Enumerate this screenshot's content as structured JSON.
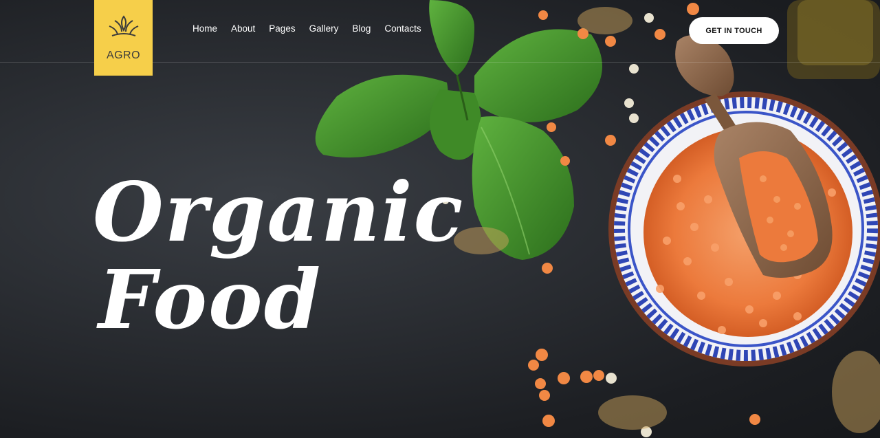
{
  "brand": {
    "name": "AGRO",
    "logo_icon": "leaf-icon",
    "accent": "#f6cf4a"
  },
  "nav": {
    "items": [
      "Home",
      "About",
      "Pages",
      "Gallery",
      "Blog",
      "Contacts"
    ]
  },
  "cta": {
    "label": "GET IN TOUCH"
  },
  "hero": {
    "line1": "Organic",
    "line2": "Food"
  },
  "colors": {
    "background": "#2a2d32",
    "text": "#ffffff",
    "lentils": "#f07a3a",
    "basil": "#3c8f2a"
  }
}
